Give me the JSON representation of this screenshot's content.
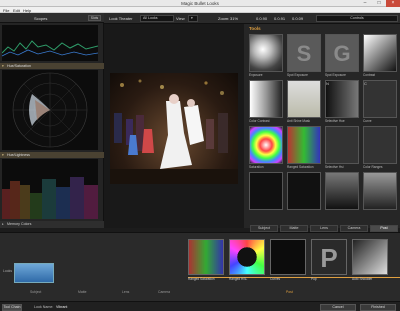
{
  "window": {
    "title": "Magic Bullet Looks"
  },
  "menu": {
    "file": "File",
    "edit": "Edit",
    "help": "Help"
  },
  "toolbar": {
    "look_theater_label": "Look Theater",
    "look_theater_value": "All Looks",
    "view_label": "View",
    "zoom_label": "Zoom:",
    "zoom_value": "31%",
    "coord1": "0.0.90",
    "coord2": "0.0.91",
    "coord3": "0.0.09",
    "controls_label": "Controls"
  },
  "left": {
    "scopes_title": "Scopes",
    "scopes_btn": "Slots",
    "sections": [
      "Hue/Saturation",
      "Hue/Lightness"
    ],
    "memory_colors": "Memory Colors"
  },
  "tools": {
    "header": "Tools",
    "items": [
      {
        "label": "Exposure"
      },
      {
        "label": "Spot Exposure"
      },
      {
        "label": "Spot Exposure"
      },
      {
        "label": "Contrast"
      },
      {
        "label": "Color Contrast"
      },
      {
        "label": "Anti Shine Mask"
      },
      {
        "label": "Selective Hue"
      },
      {
        "label": "Curve"
      },
      {
        "label": "Saturation"
      },
      {
        "label": "Ranged Saturation"
      },
      {
        "label": "Selective Hsi"
      },
      {
        "label": "Color Ranges"
      },
      {
        "label": ""
      },
      {
        "label": ""
      },
      {
        "label": ""
      },
      {
        "label": ""
      }
    ]
  },
  "tabs": [
    "Subject",
    "Matte",
    "Lens",
    "Camera",
    "Post"
  ],
  "stack": {
    "items": [
      {
        "label": "Ranged Saturation"
      },
      {
        "label": "Ranged HSL"
      },
      {
        "label": "Curves"
      },
      {
        "label": "Pop"
      },
      {
        "label": "Auto Shoulder"
      }
    ],
    "post_label": "Post",
    "left_labels": [
      "Subject",
      "Matte",
      "Lens",
      "Camera"
    ],
    "looks_label": "Looks"
  },
  "status": {
    "tool_chain": "Tool Chain",
    "look_name_label": "Look Name:",
    "look_name_value": "Vibrant",
    "cancel": "Cancel",
    "finished": "Finished"
  },
  "colors": {
    "accent": "#e0a040",
    "active_tab": "#4b4b4b"
  }
}
